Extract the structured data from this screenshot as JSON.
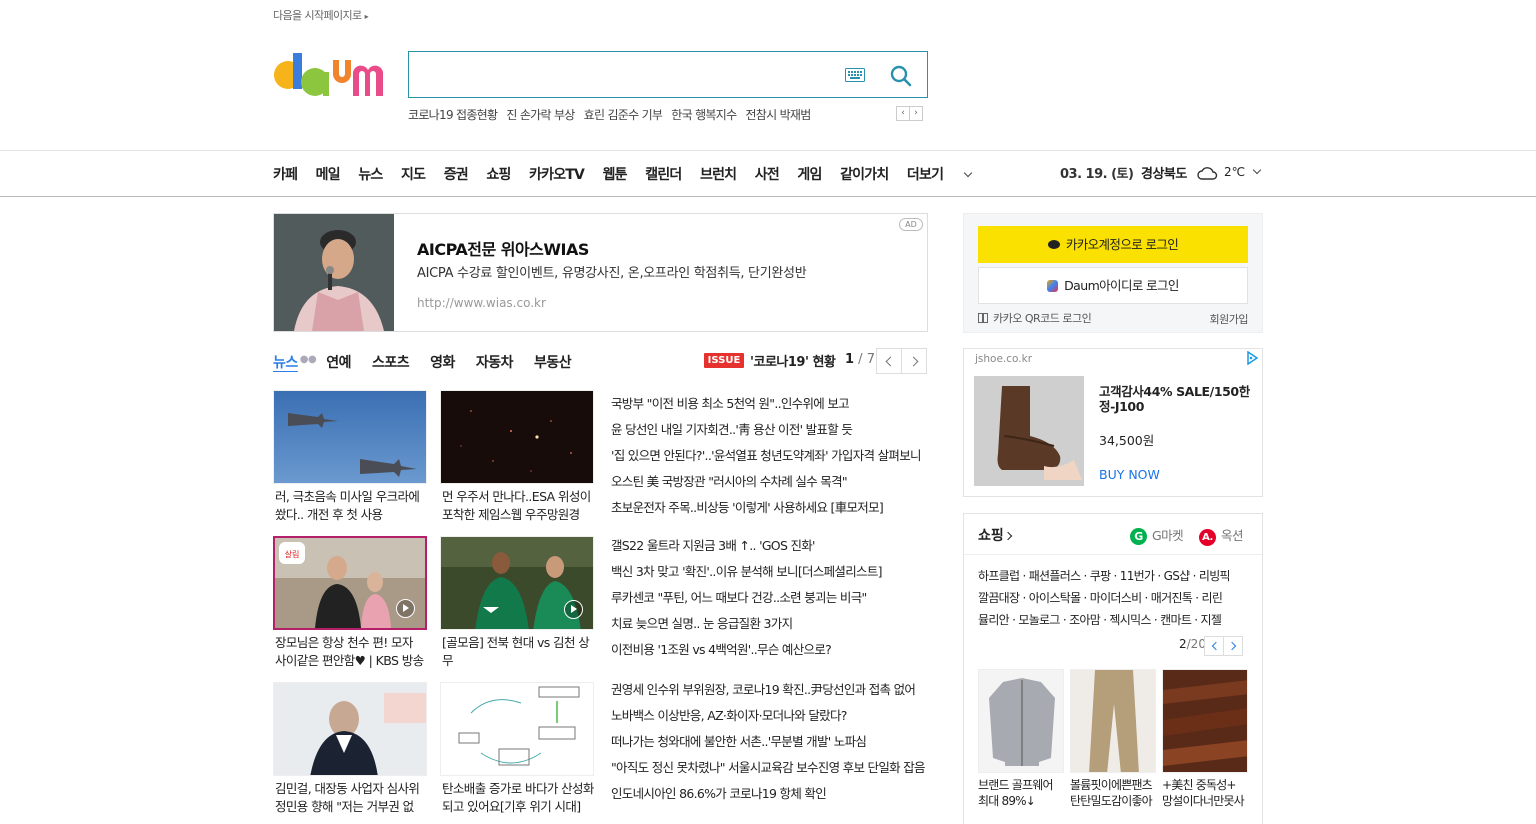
{
  "top": {
    "set_start": "다음을 시작페이지로"
  },
  "search": {
    "placeholder": "",
    "value": ""
  },
  "hot_keywords": [
    "코로나19 접종현황",
    "진 손가락 부상",
    "효린 김준수 기부",
    "한국 행복지수",
    "전참시 박재범"
  ],
  "gnb": {
    "items": [
      "카페",
      "메일",
      "뉴스",
      "지도",
      "증권",
      "쇼핑",
      "카카오TV",
      "웹툰",
      "캘린더",
      "브런치",
      "사전",
      "게임",
      "같이가치"
    ],
    "more": "더보기",
    "date": "03. 19. (토)",
    "region": "경상북도",
    "temp": "2℃"
  },
  "ad_banner": {
    "title": "AICPA전문 위아스WIAS",
    "desc": "AICPA 수강료 할인이벤트, 유명강사진, 온,오프라인 학점취득, 단기완성반",
    "url": "http://www.wias.co.kr",
    "badge": "AD"
  },
  "news_tabs": {
    "tabs": [
      "뉴스",
      "연예",
      "스포츠",
      "영화",
      "자동차",
      "부동산"
    ],
    "issue_badge": "ISSUE",
    "issue_text": "'코로나19' 현황",
    "page_current": "1",
    "page_total": " / 7"
  },
  "thumbs": [
    {
      "caption": "러, 극초음속 미사일 우크라에 쐈다.. 개전 후 첫 사용"
    },
    {
      "caption": "먼 우주서 만나다..ESA 위성이 포착한 제임스웹 우주망원경"
    },
    {
      "caption": "장모님은 항상 천수 편! 모자 사이같은 편안함♥ | KBS 방송"
    },
    {
      "caption": "[골모음] 전북 현대 vs 김천 상무"
    },
    {
      "caption": "김민걸, 대장동 사업자 심사위 정민용 향해 \"저는 거부권 없다\""
    },
    {
      "caption": "탄소배출 증가로 바다가 산성화되고 있어요[기후 위기 시대]"
    }
  ],
  "headlines": [
    [
      "국방부 \"이전 비용 최소 5천억 원\"..인수위에 보고",
      "윤 당선인 내일 기자회견..'靑 용산 이전' 발표할 듯",
      "'집 있으면 안된다?'..'윤석열표 청년도약계좌' 가입자격 살펴보니",
      "오스틴 美 국방장관 \"러시아의 수차례 실수 목격\"",
      "초보운전자 주목..비상등 '이렇게' 사용하세요 [車모저모]"
    ],
    [
      "갤S22 울트라 지원금 3배 ↑.. 'GOS 진화'",
      "백신 3차 맞고 '확진'..이유 분석해 보니[더스페셜리스트]",
      "루카센코 \"푸틴, 어느 때보다 건강..소련 붕괴는 비극\"",
      "치료 늦으면 실명.. 눈 응급질환 3가지",
      "이전비용 '1조원 vs 4백억원'..무슨 예산으로?"
    ],
    [
      "권영세 인수위 부위원장, 코로나19 확진..尹당선인과 접촉 없어",
      "노바백스 이상반응, AZ·화이자·모더나와 달랐다?",
      "떠나가는 청와대에 불안한 서촌..'무분별 개발' 노파심",
      "\"아직도 정신 못차렸나\" 서울시교육감 보수진영 후보 단일화 잡음",
      "인도네시아인 86.6%가 코로나19 항체 확인"
    ]
  ],
  "login": {
    "kakao": "카카오계정으로 로그인",
    "daum": "Daum아이디로 로그인",
    "qr": "카카오 QR코드 로그인",
    "signup": "회원가입"
  },
  "side_ad": {
    "domain": "jshoe.co.kr",
    "title": "고객감사44% SALE/150한정-J100",
    "price": "34,500원",
    "cta": "BUY NOW"
  },
  "shopping": {
    "title": "쇼핑",
    "gmarket": "G마켓",
    "auction": "옥션",
    "links": [
      "하프클럽 · 패션플러스 · 쿠팡 · 11번가 · GS샵 · 리빙픽",
      "깔끔대장 · 아이스탁몰 · 마이더스비 · 매거진톡 · 리린",
      "뮬리안 · 모놀로그 · 조아맘 · 젝시믹스 · 캔마트 · 지젤"
    ],
    "page_current": "2",
    "page_total": "/20",
    "products": [
      {
        "name": "브랜드 골프웨어 최대 89%↓"
      },
      {
        "name": "볼륨핏이에쁜팬츠 탄탄밀도감이좋아"
      },
      {
        "name": "+美친 중독성+ 망설이다너만못사"
      }
    ]
  },
  "colors": {
    "brand_blue": "#2a91ad",
    "kakao_yellow": "#fae100",
    "issue_red": "#e6322e",
    "link_blue": "#2a7ee5"
  }
}
